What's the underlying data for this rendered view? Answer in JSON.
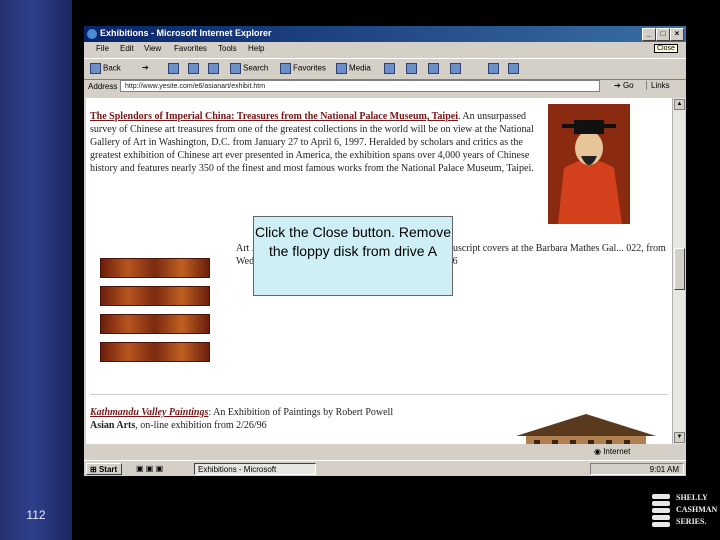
{
  "slide": {
    "page_number": "112"
  },
  "brand": {
    "line1": "SHELLY",
    "line2": "CASHMAN",
    "line3": "SERIES."
  },
  "window": {
    "title": "Exhibitions - Microsoft Internet Explorer",
    "buttons": {
      "minimize": "_",
      "maximize": "□",
      "close": "×"
    },
    "close_tooltip": "Close"
  },
  "menu": {
    "file": "File",
    "edit": "Edit",
    "view": "View",
    "favorites": "Favorites",
    "tools": "Tools",
    "help": "Help"
  },
  "toolbar": {
    "back": "Back",
    "search": "Search",
    "favorites": "Favorites",
    "media": "Media"
  },
  "address": {
    "label": "Address",
    "url": "http://www.yesite.com/e6/asianart/exhibit.htm",
    "go": "Go",
    "links": "Links"
  },
  "content": {
    "exhibit1_title": "The Splendors of Imperial China: Treasures from the National Palace Museum, Taipei",
    "exhibit1_text": ". An unsurpassed survey of Chinese art treasures from one of the greatest collections in the world will be on view at the National Gallery of Art in Washington, D.C. from January 27 to April 6, 1997. Heralded by scholars and critics as the greatest exhibition of Chinese art ever presented in America, the exhibition spans over 4,000 years of Chinese history and features nearly 350 of the finest and most famous works from the National Palace Museum, Taipei.",
    "exhibit2_visible": "Art ... dians of the Sacred Word, a fascinating exhi... nuscript covers at the Barbara Mathes Gal... 022, from Wednesday 18 September to Saturday 19 October 1996",
    "exhibit3_title": "Kathmandu Valley Paintings",
    "exhibit3_text": ": An Exhibition of Paintings by Robert Powell",
    "exhibit3_line2_bold": "Asian Arts",
    "exhibit3_line2": ", on-line exhibition from 2/26/96"
  },
  "callout": {
    "text": "Click the Close button. Remove the floppy disk from drive A"
  },
  "status": {
    "zone": "Internet"
  },
  "taskbar": {
    "start": "Start",
    "task": "Exhibitions - Microsoft",
    "clock": "9:01 AM"
  }
}
